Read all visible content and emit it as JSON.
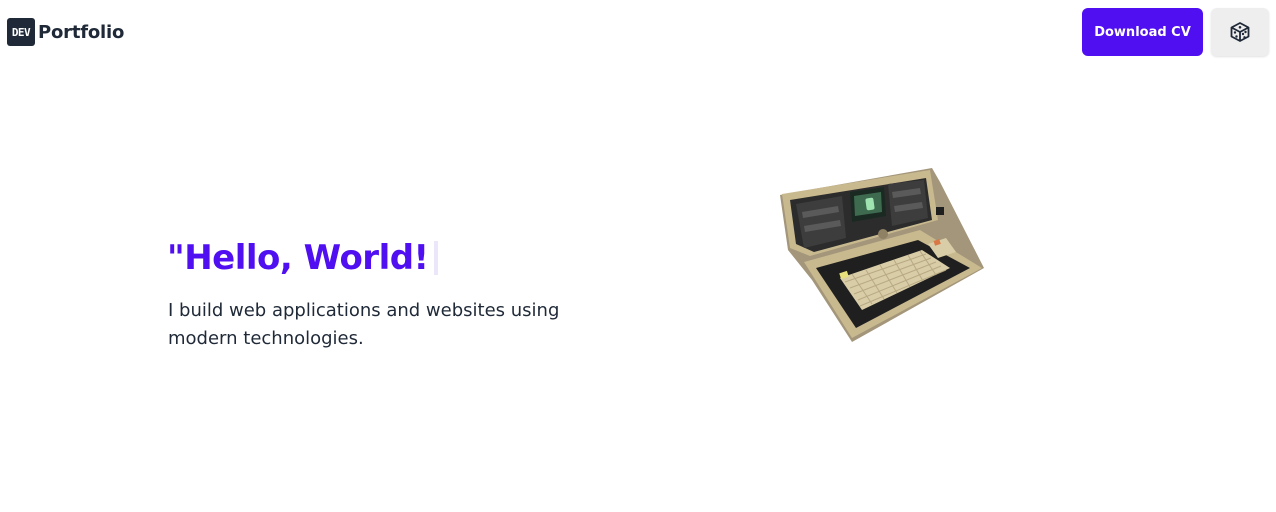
{
  "nav": {
    "brand_badge": "DEV",
    "brand_name": "Portfolio",
    "download_label": "Download CV",
    "dice_icon": "dice-3d-icon"
  },
  "hero": {
    "title": "\"Hello, World!",
    "subtitle": "I build web applications and websites using modern technologies."
  },
  "model": {
    "name": "retro-portable-computer"
  },
  "colors": {
    "accent": "#4f0ff0",
    "text": "#1f2937",
    "button_secondary": "#eeeeee"
  }
}
